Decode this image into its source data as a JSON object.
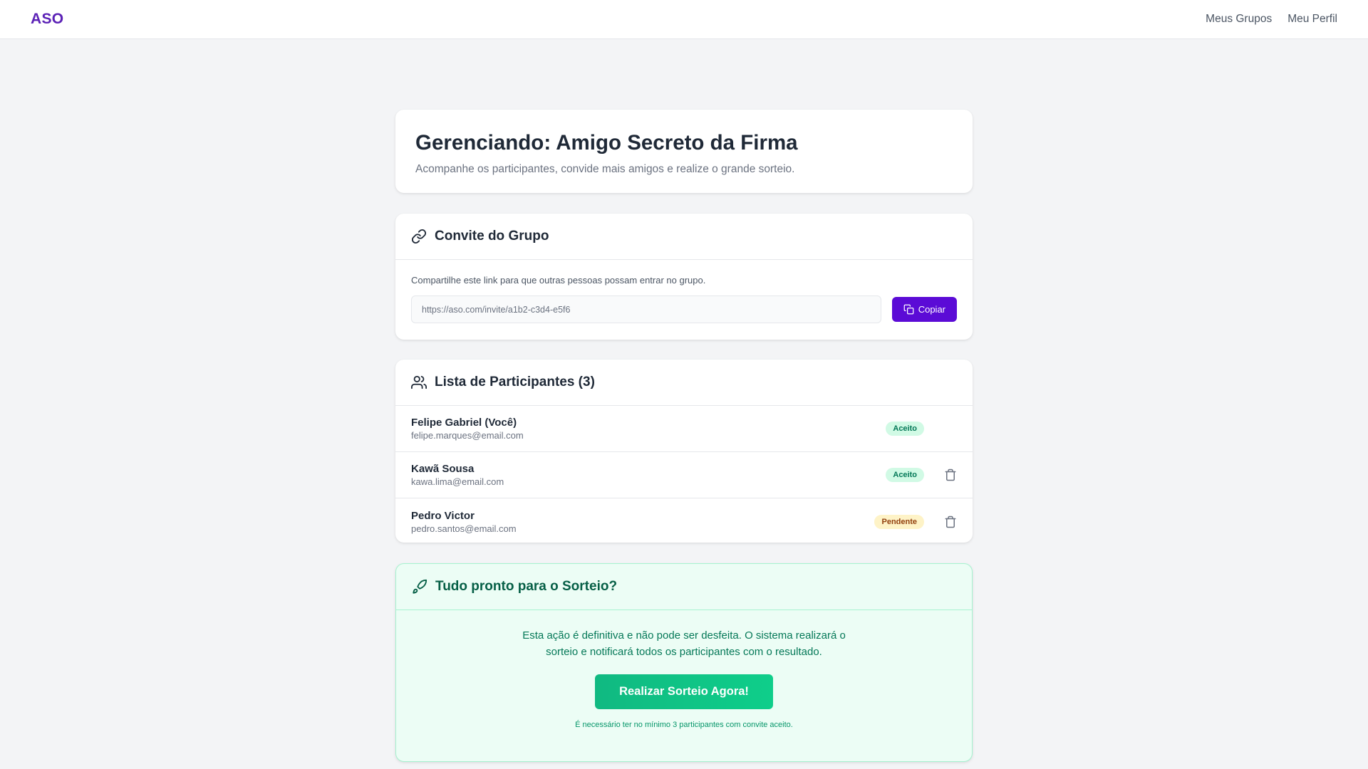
{
  "topbar": {
    "logo": "ASO",
    "nav": [
      "Meus Grupos",
      "Meu Perfil"
    ]
  },
  "hero": {
    "title": "Gerenciando: Amigo Secreto da Firma",
    "subtitle": "Acompanhe os participantes, convide mais amigos e realize o grande sorteio."
  },
  "invite": {
    "title": "Convite do Grupo",
    "icon": "link-icon",
    "hint": "Compartilhe este link para que outras pessoas possam entrar no grupo.",
    "link": "https://aso.com/invite/a1b2-c3d4-e5f6",
    "copy_label": "Copiar"
  },
  "participants": {
    "title": "Lista de Participantes (3)",
    "icon": "users-icon",
    "items": [
      {
        "name": "Felipe Gabriel (Você)",
        "email": "felipe.marques@email.com",
        "status": "Aceito",
        "removable": false
      },
      {
        "name": "Kawã Sousa",
        "email": "kawa.lima@email.com",
        "status": "Aceito",
        "removable": true
      },
      {
        "name": "Pedro Victor",
        "email": "pedro.santos@email.com",
        "status": "Pendente",
        "removable": true
      }
    ]
  },
  "draw": {
    "title": "Tudo pronto para o Sorteio?",
    "icon": "rocket-icon",
    "description": "Esta ação é definitiva e não pode ser desfeita. O sistema realizará o sorteio e notificará todos os participantes com o resultado.",
    "button_label": "Realizar Sorteio Agora!",
    "note": "É necessário ter no mínimo 3 participantes com convite aceito."
  },
  "colors": {
    "brand": "#5b0bd6",
    "success": "#10b981",
    "accepted_badge": "#d1fae5",
    "pending_badge": "#fef3c7"
  }
}
